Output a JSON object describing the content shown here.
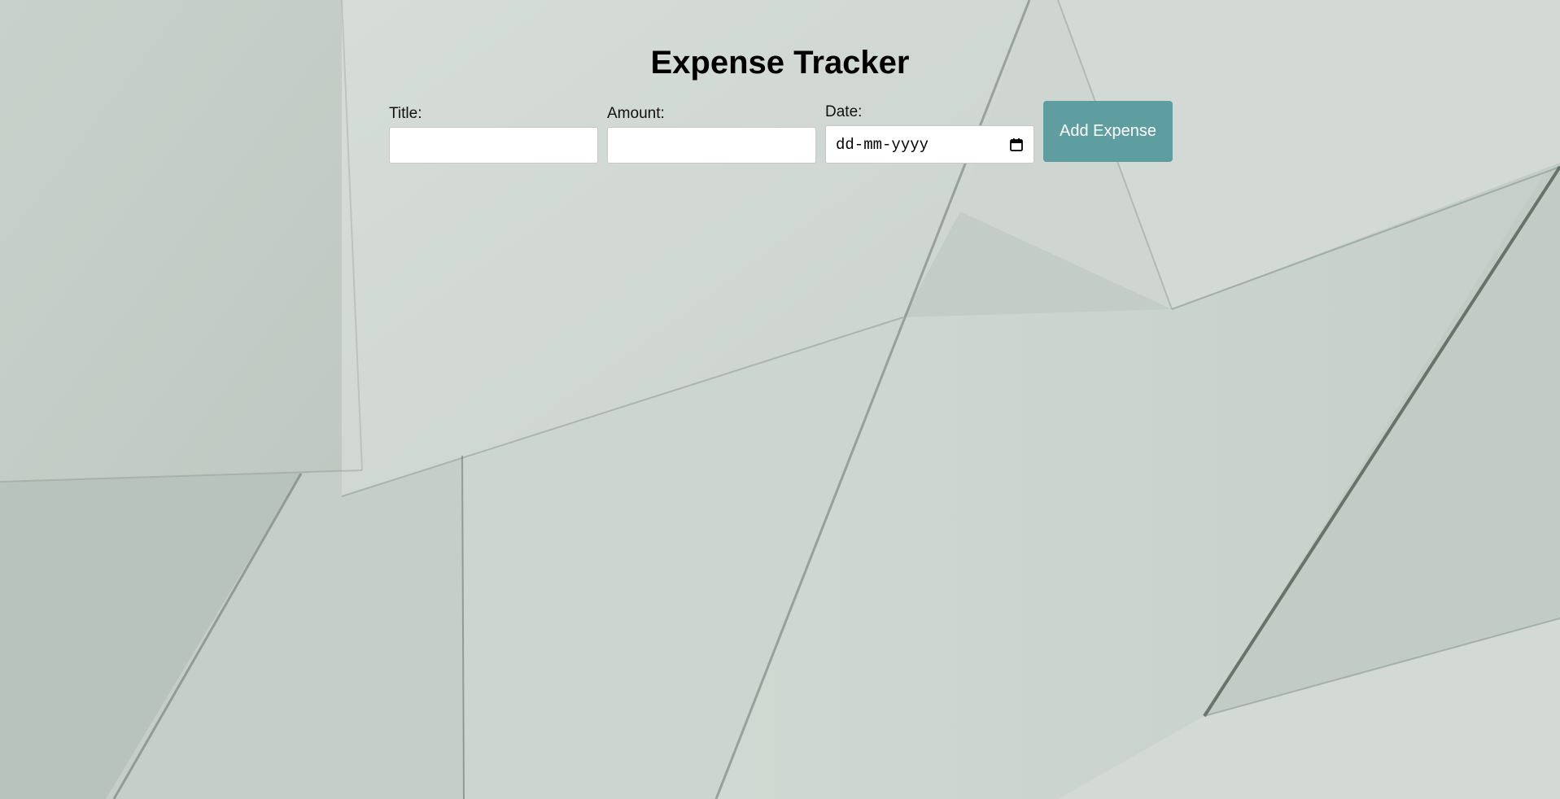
{
  "app": {
    "title": "Expense Tracker"
  },
  "form": {
    "title_label": "Title:",
    "title_value": "",
    "amount_label": "Amount:",
    "amount_value": "",
    "date_label": "Date:",
    "date_placeholder": "dd-mm-yyyy",
    "date_icon": "calendar-icon",
    "submit_label": "Add Expense"
  },
  "colors": {
    "button_bg": "#5f9ea0",
    "button_text": "#ffffff",
    "background": "#ccd4cf"
  }
}
